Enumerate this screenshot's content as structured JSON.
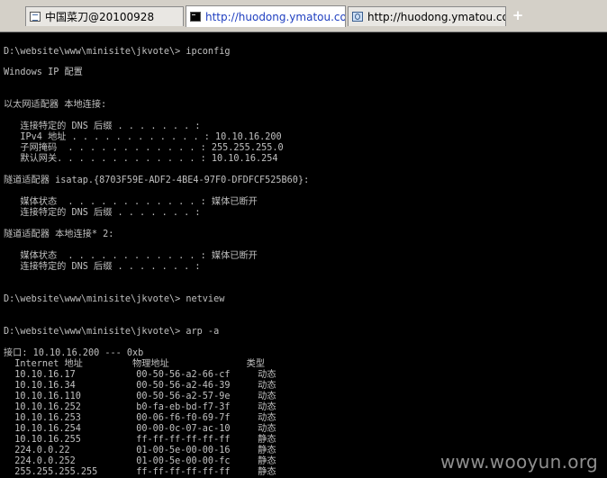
{
  "tabs": [
    {
      "label": "中国菜刀@20100928",
      "icon": "page-icon",
      "active": false
    },
    {
      "label": "http://huodong.ymatou.com/...",
      "icon": "cmd-icon",
      "active": true
    },
    {
      "label": "http://huodong.ymatou.com/...",
      "icon": "globe-icon",
      "active": false
    }
  ],
  "tab_close": "×",
  "new_tab": "+",
  "console_lines": [
    "D:\\website\\www\\minisite\\jkvote\\> ipconfig",
    "Windows IP 配置",
    "以太网适配器 本地连接:",
    "   连接特定的 DNS 后缀 . . . . . . . :",
    "   IPv4 地址 . . . . . . . . . . . . : 10.10.16.200",
    "   子网掩码  . . . . . . . . . . . . : 255.255.255.0",
    "   默认网关. . . . . . . . . . . . . : 10.10.16.254",
    "隧道适配器 isatap.{8703F59E-ADF2-4BE4-97F0-DFDFCF525B60}:",
    "   媒体状态  . . . . . . . . . . . . : 媒体已断开",
    "   连接特定的 DNS 后缀 . . . . . . . :",
    "隧道适配器 本地连接* 2:",
    "   媒体状态  . . . . . . . . . . . . : 媒体已断开",
    "   连接特定的 DNS 后缀 . . . . . . . :",
    "D:\\website\\www\\minisite\\jkvote\\> netview",
    "D:\\website\\www\\minisite\\jkvote\\> arp -a",
    "接口: 10.10.16.200 --- 0xb",
    "  Internet 地址         物理地址              类型",
    "  10.10.16.17           00-50-56-a2-66-cf     动态",
    "  10.10.16.34           00-50-56-a2-46-39     动态",
    "  10.10.16.110          00-50-56-a2-57-9e     动态",
    "  10.10.16.252          b0-fa-eb-bd-f7-3f     动态",
    "  10.10.16.253          00-06-f6-f0-69-7f     动态",
    "  10.10.16.254          00-00-0c-07-ac-10     动态",
    "  10.10.16.255          ff-ff-ff-ff-ff-ff     静态",
    "  224.0.0.22            01-00-5e-00-00-16     静态",
    "  224.0.0.252           01-00-5e-00-00-fc     静态",
    "  255.255.255.255       ff-ff-ff-ff-ff-ff     静态"
  ],
  "watermark": "www.wooyun.org"
}
